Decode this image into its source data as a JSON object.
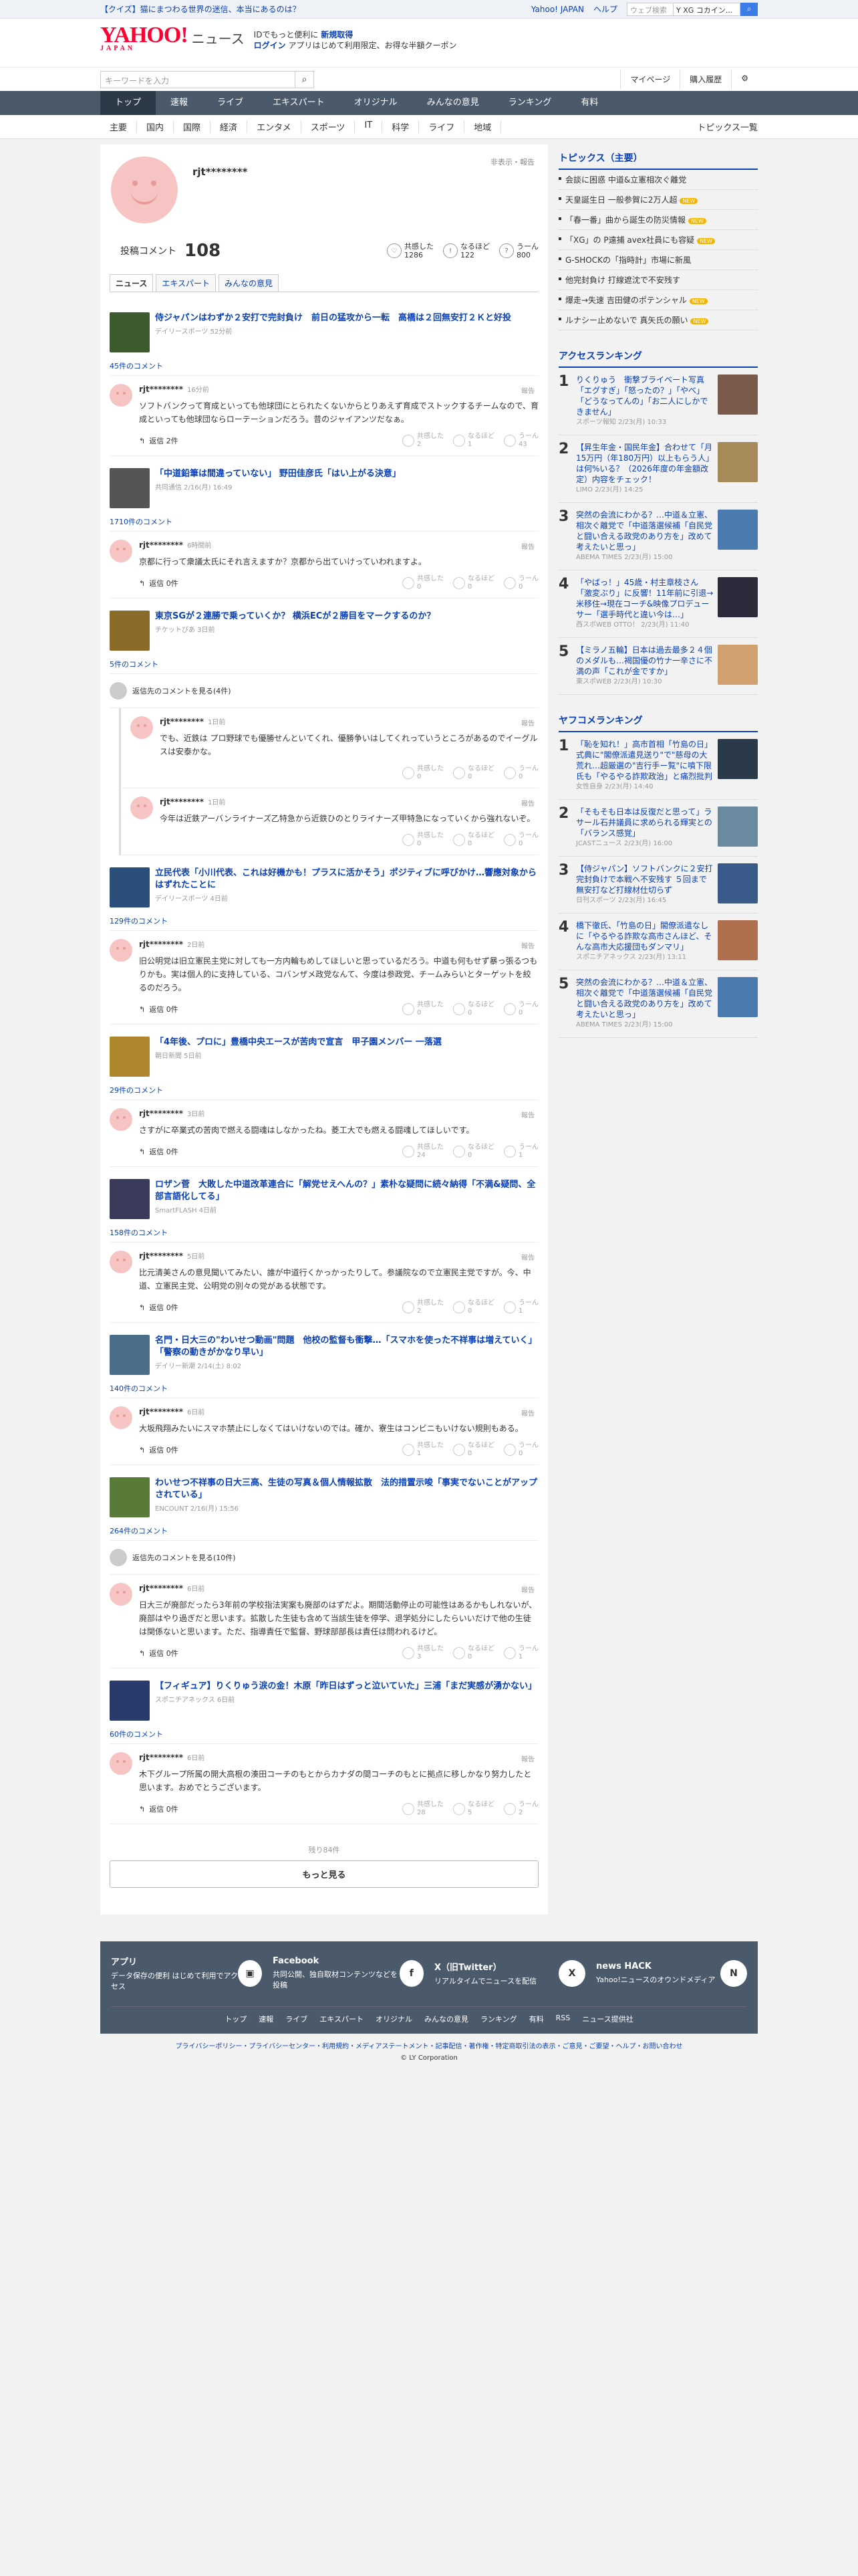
{
  "topbar": {
    "promo": "【クイズ】猫にまつわる世界の迷信、本当にあるのは？",
    "links": [
      "Yahoo! JAPAN",
      "ヘルプ"
    ],
    "search_placeholder": "ウェブ検索",
    "search_option": "Y XG コカイン..."
  },
  "header": {
    "logo": "YAHOO!",
    "logo_sub": "JAPAN",
    "section": "ニュース",
    "line1_pre": "IDでもっと便利に",
    "line1_link": "新規取得",
    "line2_login": "ログイン",
    "line2_text": "アプリはじめて利用限定、お得な半額クーポン"
  },
  "searchrow": {
    "placeholder": "キーワードを入力",
    "mypage": "マイページ",
    "history": "購入履歴"
  },
  "nav": [
    "トップ",
    "速報",
    "ライブ",
    "エキスパート",
    "オリジナル",
    "みんなの意見",
    "ランキング",
    "有料"
  ],
  "subnav": {
    "items": [
      "主要",
      "国内",
      "国際",
      "経済",
      "エンタメ",
      "スポーツ",
      "IT",
      "科学",
      "ライフ",
      "地域"
    ],
    "right": "トピックス一覧"
  },
  "profile": {
    "username": "rjt********",
    "report": "非表示・報告",
    "count_label": "投稿コメント",
    "count": "108",
    "reactions": [
      {
        "label": "共感した",
        "value": "1286"
      },
      {
        "label": "なるほど",
        "value": "122"
      },
      {
        "label": "うーん",
        "value": "800"
      }
    ]
  },
  "tabs": [
    "ニュース",
    "エキスパート",
    "みんなの意見"
  ],
  "labels": {
    "reply": "返信",
    "report": "報告",
    "agree": "共感した",
    "naruhodo": "なるほど",
    "hmm": "うーん"
  },
  "articles": [
    {
      "title": "侍ジャパンはわずか２安打で完封負け　前日の猛攻から一転　高橋は２回無安打２Ｋと好投",
      "source": "デイリースポーツ 52分前",
      "comments": "45件のコメント",
      "color": "#3d5a2e",
      "items": [
        {
          "time": "16分前",
          "text": "ソフトバンクって育成といっても他球団にとられたくないからとりあえず育成でストックするチームなので、育成といっても他球団ならローテーションだろう。昔のジャイアンツだなぁ。",
          "reply": "返信 2件",
          "a": "2",
          "b": "1",
          "c": "43"
        }
      ]
    },
    {
      "title": "「中道鉛筆は間違っていない」 野田佳彦氏「はい上がる決意」",
      "source": "共同通信 2/16(月) 16:49",
      "comments": "1710件のコメント",
      "color": "#555",
      "items": [
        {
          "time": "6時間前",
          "text": "京都に行って衆議太氏にそれ言えますか？京都から出ていけっていわれますよ。",
          "reply": "返信 0件",
          "a": "0",
          "b": "0",
          "c": "0"
        }
      ]
    },
    {
      "title": "東京SGが２連勝で乗っていくか？ 横浜ECが２勝目をマークするのか？",
      "source": "チケットぴあ 3日前",
      "comments": "5件のコメント",
      "color": "#8a6b2a",
      "viewall": "返信先のコメントを見る(4件)",
      "items": [
        {
          "time": "1日前",
          "text": "でも、近鉄は プロ野球でも優勝せんといてくれ、優勝争いはしてくれっていうところがあるのでイーグルスは安泰かな。",
          "reply": "",
          "a": "0",
          "b": "0",
          "c": "0",
          "nested": true
        },
        {
          "time": "1日前",
          "text": "今年は近鉄アーバンライナーズ乙特急から近鉄ひのとりライナーズ甲特急になっていくから強れないぞ。",
          "reply": "",
          "a": "0",
          "b": "0",
          "c": "0",
          "nested": true
        }
      ]
    },
    {
      "title": "立民代表「小川代表、これは好機かも！プラスに活かそう」ポジティブに呼びかけ…響應対象からはずれたことに",
      "source": "デイリースポーツ 4日前",
      "comments": "129件のコメント",
      "color": "#2a4f7a",
      "items": [
        {
          "time": "2日前",
          "text": "旧公明党は旧立憲民主党に対しても一方内輪もめしてほしいと思っているだろう。中道も何もせず暴っ張るつもりかも。実は個人的に支持している、コバンザメ政党なんて、今度は参政党、チームみらいとターゲットを絞るのだろう。",
          "reply": "返信 0件",
          "a": "0",
          "b": "0",
          "c": "0"
        }
      ]
    },
    {
      "title": "「4年後、プロに」豊橋中央エースが苦肉で宣言　甲子園メンバー 一落選",
      "source": "朝日新聞 5日前",
      "comments": "29件のコメント",
      "color": "#b0862d",
      "items": [
        {
          "time": "3日前",
          "text": "さすがに卒業式の苦肉で燃える闘魂はしなかったね。菱工大でも燃える闘魂してほしいです。",
          "reply": "返信 0件",
          "a": "24",
          "b": "0",
          "c": "1"
        }
      ]
    },
    {
      "title": "ロザン菅　大敗した中道改革連合に「解党せえへんの？」素朴な疑問に続々納得「不満&疑問、全部言語化してる」",
      "source": "SmartFLASH 4日前",
      "comments": "158件のコメント",
      "color": "#3a3a5a",
      "items": [
        {
          "time": "5日前",
          "text": "比元清美さんの意見聞いてみたい、誰が中道行くかっかったりして。参議院なので立憲民主党ですが。今、中道、立憲民主党、公明党の別々の党がある状態です。",
          "reply": "返信 0件",
          "a": "2",
          "b": "0",
          "c": "1"
        }
      ]
    },
    {
      "title": "名門・日大三の\"わいせつ動画\"問題　他校の監督も衝撃…「スマホを使った不祥事は増えていく」「警察の動きがかなり早い」",
      "source": "デイリー新潮 2/14(土) 8:02",
      "comments": "140件のコメント",
      "color": "#4a6d8a",
      "items": [
        {
          "time": "6日前",
          "text": "大坂飛翔みたいにスマホ禁止にしなくてはいけないのでは。確か、寮生はコンビニもいけない規則もある。",
          "reply": "返信 0件",
          "a": "1",
          "b": "0",
          "c": "0"
        }
      ]
    },
    {
      "title": "わいせつ不祥事の日大三高、生徒の写真＆個人情報拡散　法的措置示唆「事実でないことがアップされている」",
      "source": "ENCOUNT 2/16(月) 15:56",
      "comments": "264件のコメント",
      "color": "#5a7a3a",
      "viewall": "返信先のコメントを見る(10件)",
      "items": [
        {
          "time": "6日前",
          "text": "日大三が廃部だったら3年前の学校指法実案も廃部のはずだよ。期間活動停止の可能性はあるかもしれないが、廃部はやり過ぎだと思います。拡散した生徒も含めて当該生徒を停学、退学処分にしたらいいだけで他の生徒は関係ないと思います。ただ、指導責任で監督、野球部部長は責任は問われるけど。",
          "reply": "返信 0件",
          "a": "3",
          "b": "0",
          "c": "1"
        }
      ]
    },
    {
      "title": "【フィギュア】りくりゅう涙の金！木原「昨日はずっと泣いていた」三浦「まだ実感が湧かない」",
      "source": "スポニチアネックス 6日前",
      "comments": "60件のコメント",
      "color": "#2a3a6a",
      "items": [
        {
          "time": "6日前",
          "text": "木下グループ所属の開大高根の湊田コーチのもとからカナダの間コーチのもとに拠点に移しかなり努力したと思います。おめでとうございます。",
          "reply": "返信 0件",
          "a": "28",
          "b": "5",
          "c": "2"
        }
      ]
    }
  ],
  "more": {
    "remaining": "残り84件",
    "button": "もっと見る"
  },
  "sidebar": {
    "topics_title": "トピックス（主要）",
    "topics": [
      {
        "t": "会談に困惑 中道&立憲相次ぐ離党",
        "new": false
      },
      {
        "t": "天皇誕生日 一般参賀に2万人超",
        "new": true
      },
      {
        "t": "「春一番」曲から誕生の防災情報",
        "new": true
      },
      {
        "t": "「XG」の P遠捕 avex社員にも容疑",
        "new": true
      },
      {
        "t": "G-SHOCKの「指時計」市場に新風",
        "new": false
      },
      {
        "t": "他完封負け 打線遮沈で不安残す",
        "new": false
      },
      {
        "t": "爆走→失速 吉田健のポテンシャル",
        "new": true
      },
      {
        "t": "ルナシー止めないで 真矢氏の願い",
        "new": true
      }
    ],
    "access_title": "アクセスランキング",
    "access": [
      {
        "t": "りくりゅう　衝撃ブライベート写真「エグすぎ」「怒ったの？」「やべ」「どうなってんの」「お二人にしかできません」",
        "s": "スポーツ報知 2/23(月) 10:33",
        "c": "#7a5a4a"
      },
      {
        "t": "【昇生年金・国民年金】合わせて「月15万円（年180万円）以上もらう人」は何%いる？（2026年度の年金額改定）内容をチェック！",
        "s": "LIMO 2/23(月) 14:25",
        "c": "#a68a5a"
      },
      {
        "t": "突然の会流にわかる？…中道＆立憲、相次ぐ離党で「中道落選候補「自民党と闘い合える政党のあり方を」改めて考えたいと思っ」",
        "s": "ABEMA TIMES 2/23(月) 15:00",
        "c": "#4a7ab0"
      },
      {
        "t": "「やばっ！」45歳・村主章枝さん「激変ぶり」に反響！11年前に引退→米移住→現在コーチ&映像プロデューサー「選手時代と違い今は…」",
        "s": "西スポWEB OTTO！ 2/23(月) 11:40",
        "c": "#2a2a3a"
      },
      {
        "t": "【ミラノ五輪】日本は過去最多２４個のメダルも…褐国優の竹ナ一辛さに不満の声「これが金ですか」",
        "s": "東スポWEB 2/23(月) 10:30",
        "c": "#d0a070"
      }
    ],
    "yafuko_title": "ヤフコメランキング",
    "yafuko": [
      {
        "t": "「恥を知れ！」高市首相「竹島の日」式典に\"閣僚派遣見送り\"で\"慈母の大荒れ…超厳選の\"吉行手ー覧\"に噴下限氏も「やるやる詐欺政治」と痛烈批判",
        "s": "女性自身 2/23(月) 14:40",
        "c": "#2a3a4a"
      },
      {
        "t": "「そもそも日本は反復だと思って」ラサール石井議員に求められる輝実との「バランス感覚」",
        "s": "JCASTニュース 2/23(月) 16:00",
        "c": "#6a8aa0"
      },
      {
        "t": "【侍ジャパン】ソフトバンクに２安打完封負けで本戦へ不安残す ５回まで無安打など打線材仕切らず",
        "s": "日刊スポーツ 2/23(月) 16:45",
        "c": "#3a5a8a"
      },
      {
        "t": "橋下徹氏、「竹島の日」閣僚派遣なしに「やるやる詐欺な高市さんほど、そんな高市大応援団もダンマリ」",
        "s": "スポニチアネックス 2/23(月) 13:11",
        "c": "#b07050"
      },
      {
        "t": "突然の会流にわかる？…中道＆立憲、相次ぐ離党で「中道落選候補「自民党と闘い合える政党のあり方を」改めて考えたいと思っ」",
        "s": "ABEMA TIMES 2/23(月) 15:00",
        "c": "#4a7ab0"
      }
    ]
  },
  "footer": {
    "cards": [
      {
        "title": "アプリ",
        "text": "データ保存の便利 はじめて利用でアクセス",
        "icon": "app-icon"
      },
      {
        "title": "Facebook",
        "text": "共同公開、独自取材コンテンツなどを投稿",
        "icon": "facebook-icon"
      },
      {
        "title": "X（旧Twitter）",
        "text": "リアルタイムでニュースを配信",
        "icon": "x-icon"
      },
      {
        "title": "news HACK",
        "text": "Yahoo!ニュースのオウンドメディア",
        "icon": "newshack-icon"
      }
    ],
    "links": [
      "トップ",
      "速報",
      "ライブ",
      "エキスパート",
      "オリジナル",
      "みんなの意見",
      "ランキング",
      "有料",
      "RSS",
      "ニュース提供社"
    ],
    "legal": "プライバシーポリシー・プライバシーセンター・利用規約・メディアステートメント・記事配信・著作権・特定商取引法の表示・ご意見・ご要望・ヘルプ・お問い合わせ",
    "copyright": "© LY Corporation"
  }
}
